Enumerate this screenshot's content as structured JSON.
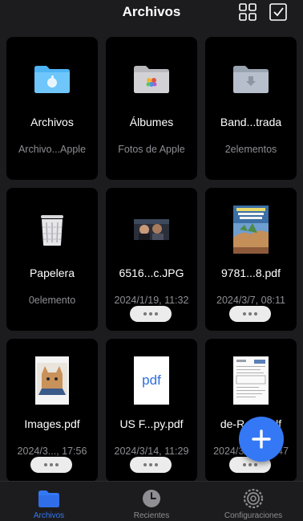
{
  "header": {
    "title": "Archivos"
  },
  "items": [
    {
      "name": "Archivos",
      "subtitle": "Archivo...Apple",
      "icon": "icloud-folder-icon"
    },
    {
      "name": "Álbumes",
      "subtitle": "Fotos de Apple",
      "icon": "photos-folder-icon"
    },
    {
      "name": "Band...trada",
      "subtitle": "2elementos",
      "icon": "inbox-folder-icon"
    },
    {
      "name": "Papelera",
      "subtitle": "0elemento",
      "icon": "trash-icon"
    },
    {
      "name": "6516...c.JPG",
      "subtitle": "2024/1/19, 11:32",
      "icon": "photo-thumbnail"
    },
    {
      "name": "9781...8.pdf",
      "subtitle": "2024/3/7, 08:11",
      "icon": "book-cover-thumbnail"
    },
    {
      "name": "Images.pdf",
      "subtitle": "2024/3..., 17:56",
      "icon": "cat-image-thumbnail"
    },
    {
      "name": "US F...py.pdf",
      "subtitle": "2024/3/14, 11:29",
      "icon": "pdf-file-icon",
      "badge": "pdf"
    },
    {
      "name": "de-R...el.pdf",
      "subtitle": "2024/3/14, 09:47",
      "icon": "document-thumbnail"
    }
  ],
  "tabs": [
    {
      "label": "Archivos",
      "icon": "folder-icon",
      "active": true
    },
    {
      "label": "Recientes",
      "icon": "clock-icon",
      "active": false
    },
    {
      "label": "Configuraciones",
      "icon": "gear-icon",
      "active": false
    }
  ],
  "colors": {
    "accent": "#3478f6",
    "background": "#1c1c1e",
    "card": "#000000",
    "secondary_text": "#8e8e93"
  }
}
